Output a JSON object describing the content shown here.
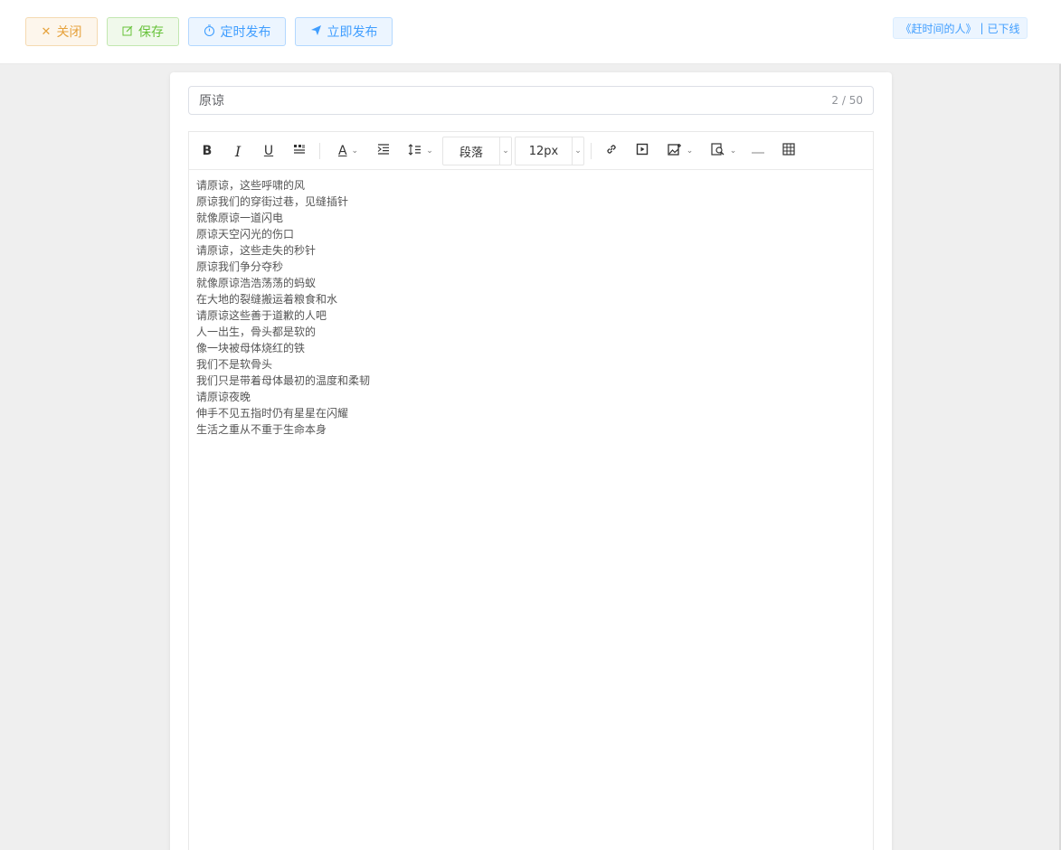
{
  "header": {
    "close_label": "关闭",
    "save_label": "保存",
    "timed_publish_label": "定时发布",
    "publish_now_label": "立即发布",
    "status_tag": {
      "title": "《赶时间的人》",
      "separator": "|",
      "status": "已下线"
    }
  },
  "title_field": {
    "value": "原谅",
    "char_count": "2 / 50"
  },
  "toolbar": {
    "bold_label": "B",
    "italic_label": "I",
    "underline_label": "U",
    "font_color_label": "A",
    "paragraph_select": "段落",
    "font_size_select": "12px"
  },
  "editor": {
    "lines": [
      "请原谅，这些呼啸的风",
      "原谅我们的穿街过巷，见缝插针",
      "就像原谅一道闪电",
      "原谅天空闪光的伤口",
      "请原谅，这些走失的秒针",
      "原谅我们争分夺秒",
      "就像原谅浩浩荡荡的蚂蚁",
      "在大地的裂缝搬运着粮食和水",
      "请原谅这些善于道歉的人吧",
      "人一出生，骨头都是软的",
      "像一块被母体烧红的铁",
      "我们不是软骨头",
      "我们只是带着母体最初的温度和柔韧",
      "请原谅夜晚",
      "伸手不见五指时仍有星星在闪耀",
      "生活之重从不重于生命本身"
    ]
  },
  "colors": {
    "warning": "#e6a23c",
    "success": "#67c23a",
    "primary": "#409eff"
  }
}
